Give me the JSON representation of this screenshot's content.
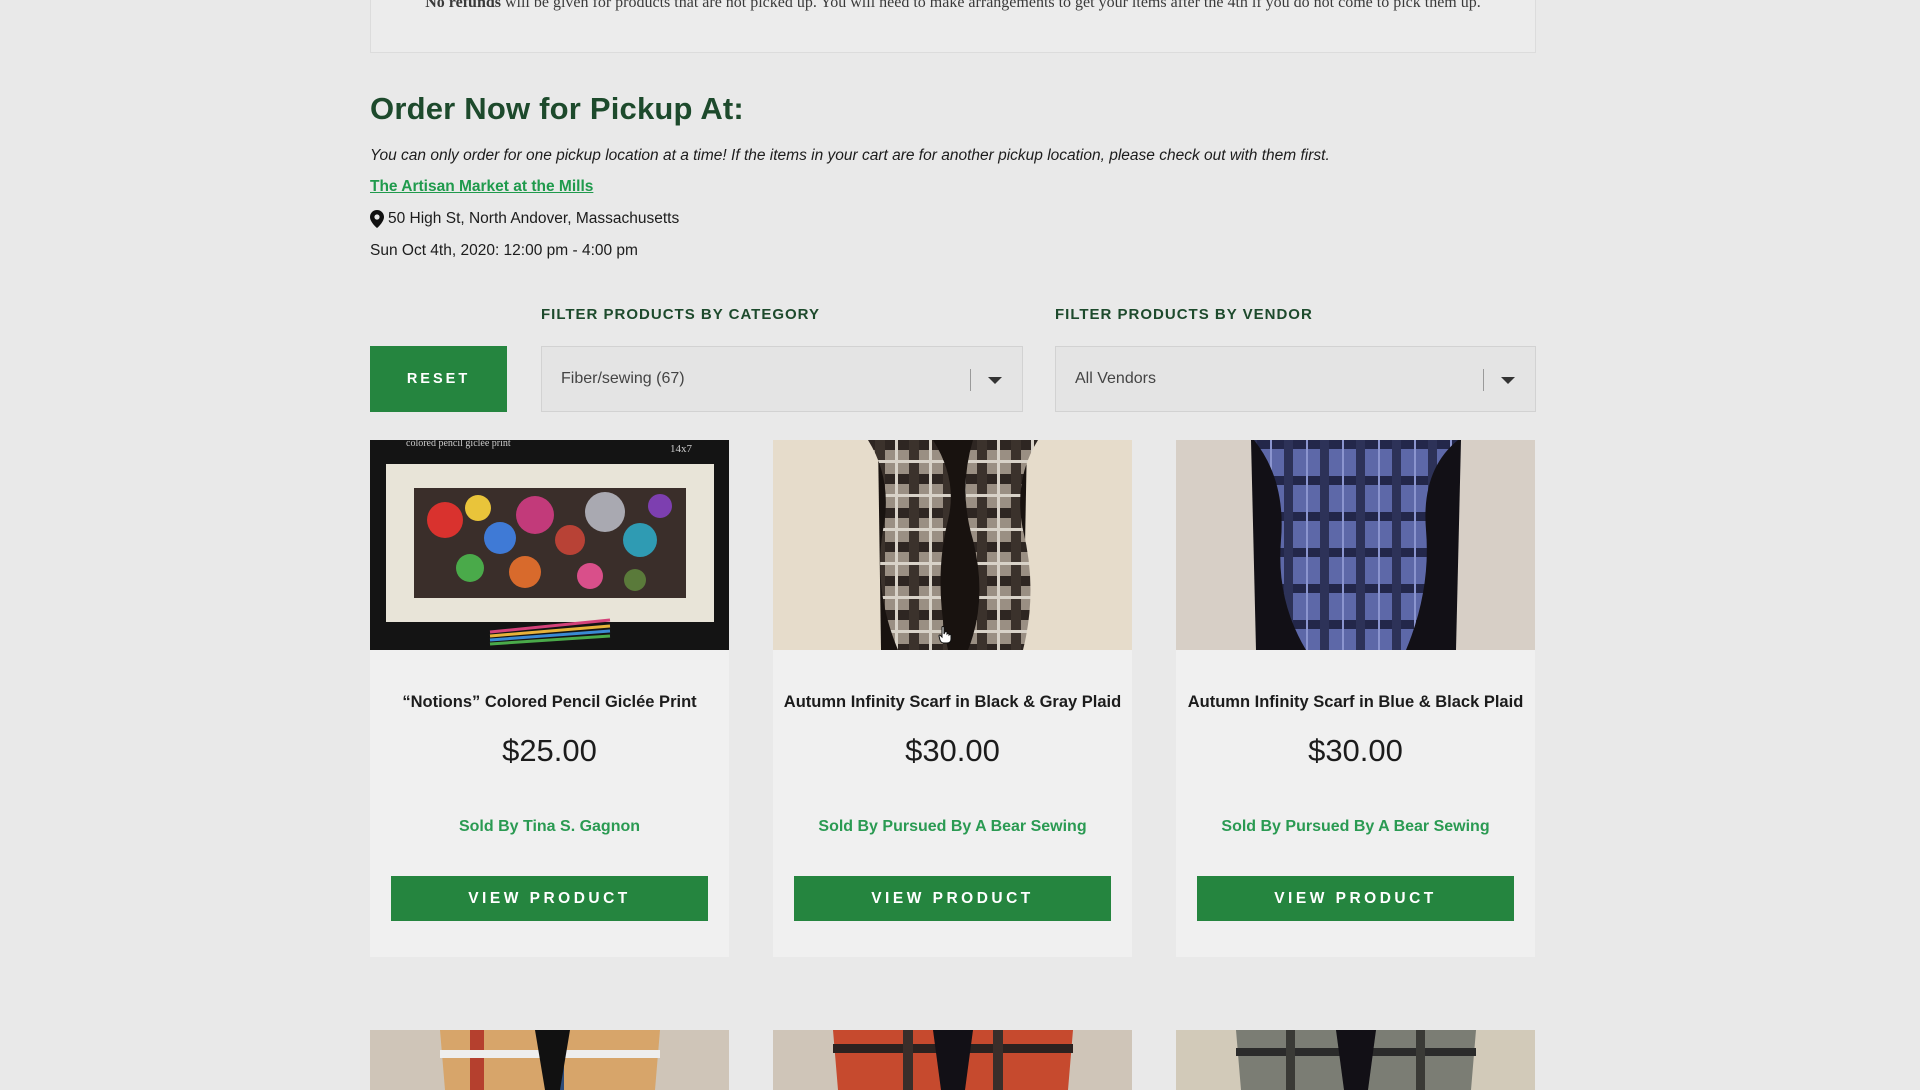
{
  "notice": {
    "bold_text": "No refunds",
    "text": " will be given for products that are not picked up. You will need to make arrangements to get your items after the 4th if you do not come to pick them up."
  },
  "pickup": {
    "heading": "Order Now for Pickup At:",
    "note": "You can only order for one pickup location at a time! If the items in your cart are for another pickup location, please check out with them first.",
    "location_name": "The Artisan Market at the Mills",
    "address": "50 High St, North Andover, Massachusetts",
    "datetime": "Sun Oct 4th, 2020: 12:00 pm - 4:00 pm"
  },
  "filters": {
    "reset_label": "RESET",
    "category_label": "FILTER PRODUCTS BY CATEGORY",
    "category_value": "Fiber/sewing (67)",
    "vendor_label": "FILTER PRODUCTS BY VENDOR",
    "vendor_value": "All Vendors"
  },
  "products": [
    {
      "title": "“Notions” Colored Pencil Giclée Print",
      "price": "$25.00",
      "vendor": "Sold By Tina S. Gagnon",
      "button": "VIEW PRODUCT",
      "image_text_left": "colored pencil giclée print",
      "image_text_right": "14x7"
    },
    {
      "title": "Autumn Infinity Scarf in Black & Gray Plaid",
      "price": "$30.00",
      "vendor": "Sold By Pursued By A Bear Sewing",
      "button": "VIEW PRODUCT"
    },
    {
      "title": "Autumn Infinity Scarf in Blue & Black Plaid",
      "price": "$30.00",
      "vendor": "Sold By Pursued By A Bear Sewing",
      "button": "VIEW PRODUCT"
    }
  ],
  "colors": {
    "brand_green": "#25853f",
    "heading_green": "#1d4a2c",
    "link_green": "#1f9a4c"
  }
}
